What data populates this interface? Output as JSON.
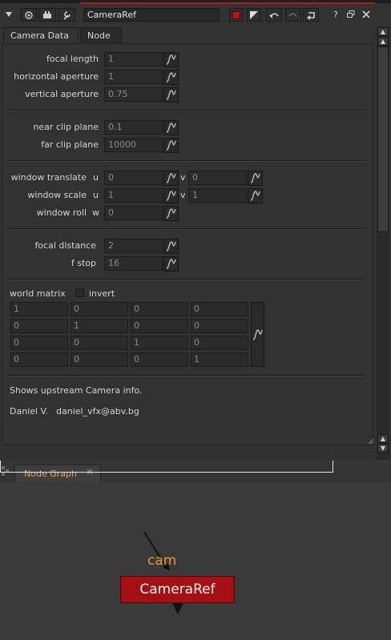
{
  "header": {
    "node_name": "CameraRef",
    "icons": [
      "collapse-arrow-icon",
      "eye-icon",
      "plugin-icon",
      "wrench-icon",
      "node-color-icon",
      "gradient-color-icon",
      "undo-icon",
      "redo-icon",
      "revert-icon",
      "help-icon",
      "float-window-icon",
      "close-icon"
    ],
    "help_glyph": "?"
  },
  "tabs": [
    {
      "label": "Camera Data",
      "active": true
    },
    {
      "label": "Node",
      "active": false
    }
  ],
  "camera_data": {
    "focal_length": {
      "label": "focal length",
      "value": "1"
    },
    "horizontal_aperture": {
      "label": "horizontal aperture",
      "value": "1"
    },
    "vertical_aperture": {
      "label": "vertical aperture",
      "value": "0.75"
    },
    "near_clip": {
      "label": "near clip plane",
      "value": "0.1"
    },
    "far_clip": {
      "label": "far clip plane",
      "value": "10000"
    },
    "window_translate": {
      "label": "window translate",
      "axis1": "u",
      "value_u": "0",
      "axis2": "v",
      "value_v": "0"
    },
    "window_scale": {
      "label": "window scale",
      "axis1": "u",
      "value_u": "1",
      "axis2": "v",
      "value_v": "1"
    },
    "window_roll": {
      "label": "window roll",
      "axis": "w",
      "value": "0"
    },
    "focal_distance": {
      "label": "focal distance",
      "value": "2"
    },
    "f_stop": {
      "label": "f stop",
      "value": "16"
    },
    "world_matrix": {
      "label": "world matrix",
      "invert_label": "invert",
      "invert_checked": false,
      "rows": [
        [
          "1",
          "0",
          "0",
          "0"
        ],
        [
          "0",
          "1",
          "0",
          "0"
        ],
        [
          "0",
          "0",
          "1",
          "0"
        ],
        [
          "0",
          "0",
          "0",
          "1"
        ]
      ]
    },
    "info_text": "Shows upstream Camera info.",
    "author_name": "Daniel V.",
    "author_email": "daniel_vfx@abv.bg"
  },
  "node_graph": {
    "tab_label": "Node Graph",
    "node_label": "CameraRef",
    "input_label": "cam",
    "node_color": "#a30f12",
    "input_label_color": "#e39a3e"
  }
}
